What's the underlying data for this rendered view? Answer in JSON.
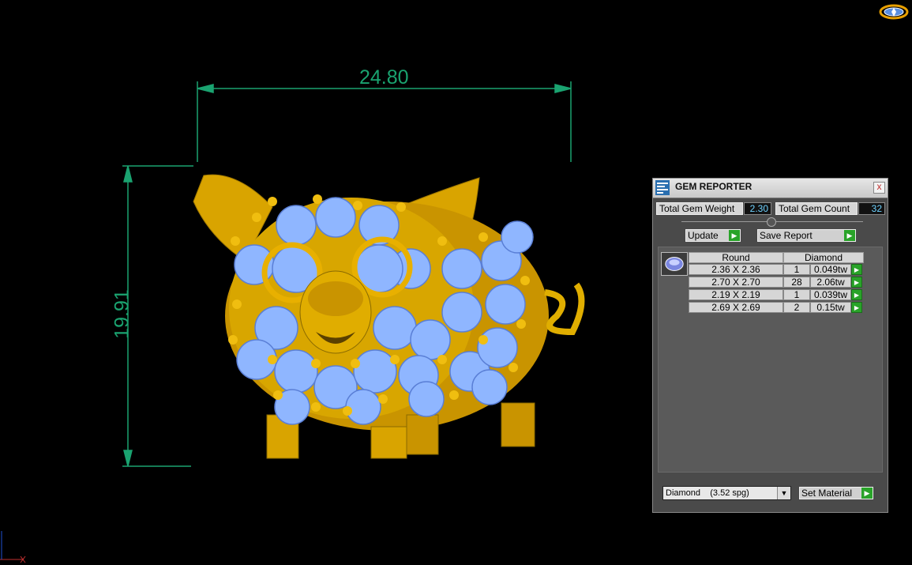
{
  "viewport": {
    "dimension_width": "24.80",
    "dimension_height": "19.91",
    "dimension_color": "#1aa370",
    "model_color": "#e8b000",
    "gem_color": "#8fb6ff"
  },
  "panel": {
    "title": "GEM REPORTER",
    "close_label": "x",
    "total_weight_label": "Total Gem Weight",
    "total_weight_value": "2.30",
    "total_count_label": "Total Gem Count",
    "total_count_value": "32",
    "update_label": "Update",
    "save_report_label": "Save Report",
    "table": {
      "shape_header": "Round",
      "material_header": "Diamond",
      "rows": [
        {
          "size": "2.36 X 2.36",
          "count": "1",
          "weight": "0.049tw"
        },
        {
          "size": "2.70 X 2.70",
          "count": "28",
          "weight": "2.06tw"
        },
        {
          "size": "2.19 X 2.19",
          "count": "1",
          "weight": "0.039tw"
        },
        {
          "size": "2.69 X 2.69",
          "count": "2",
          "weight": "0.15tw"
        }
      ]
    },
    "material_select": "Diamond    (3.52 spg)",
    "set_material_label": "Set Material"
  }
}
